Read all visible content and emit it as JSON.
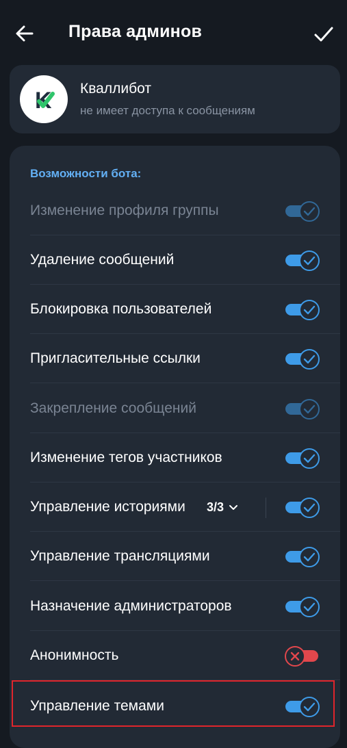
{
  "header": {
    "title": "Права админов"
  },
  "bot": {
    "name": "Квалли бот",
    "name_display": "Кваллибот",
    "status": "не имеет доступа к сообщениям",
    "avatar_letter": "K"
  },
  "rights": {
    "section_title": "Возможности бота:",
    "items": [
      {
        "label": "Изменение профиля группы",
        "state": "on",
        "disabled": true
      },
      {
        "label": "Удаление сообщений",
        "state": "on",
        "disabled": false
      },
      {
        "label": "Блокировка пользователей",
        "state": "on",
        "disabled": false
      },
      {
        "label": "Пригласительные ссылки",
        "state": "on",
        "disabled": false
      },
      {
        "label": "Закрепление сообщений",
        "state": "on",
        "disabled": true
      },
      {
        "label": "Изменение тегов участников",
        "state": "on",
        "disabled": false
      },
      {
        "label": "Управление историями",
        "state": "on",
        "disabled": false,
        "count": "3/3"
      },
      {
        "label": "Управление трансляциями",
        "state": "on",
        "disabled": false
      },
      {
        "label": "Назначение администраторов",
        "state": "on",
        "disabled": false
      },
      {
        "label": "Анонимность",
        "state": "off",
        "disabled": false
      },
      {
        "label": "Управление темами",
        "state": "on",
        "disabled": false,
        "highlighted": true
      }
    ]
  },
  "colors": {
    "background": "#151a21",
    "card": "#222a35",
    "accent": "#3e9be8",
    "section_title": "#63b0f5",
    "toggle_off": "#e2474c",
    "highlight_border": "#e0252c"
  }
}
